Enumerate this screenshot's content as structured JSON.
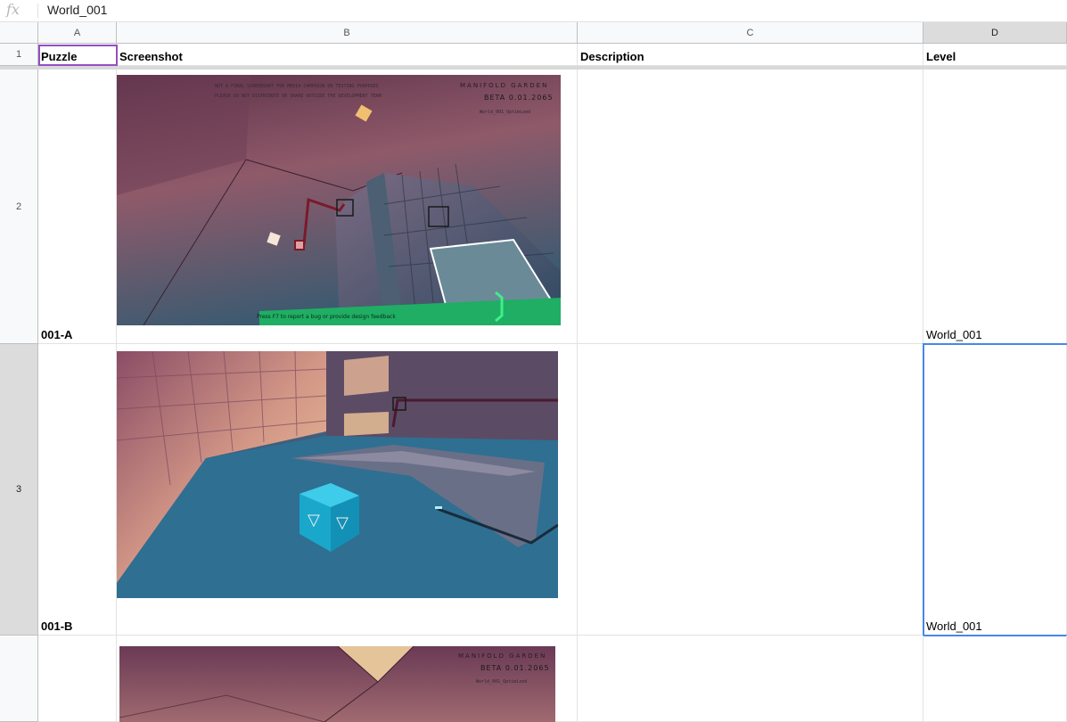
{
  "formula_bar": {
    "icon": "fx-icon",
    "fx_label": "fx",
    "value": "World_001"
  },
  "columns": [
    {
      "id": "A",
      "label": "A"
    },
    {
      "id": "B",
      "label": "B"
    },
    {
      "id": "C",
      "label": "C"
    },
    {
      "id": "D",
      "label": "D"
    }
  ],
  "rows": [
    {
      "num": "1",
      "puzzle": "Puzzle",
      "screenshot": "Screenshot",
      "description": "Description",
      "level": "Level"
    },
    {
      "num": "2",
      "puzzle": "001-A",
      "screenshot_image": "game-screenshot",
      "description": "",
      "level": "World_001",
      "overlay": {
        "line1": "NOT A FINAL SCREENSHOT FOR MEDIA CAMPAIGN OR TESTING PURPOSES",
        "line2": "PLEASE DO NOT DISTRIBUTE OR SHARE OUTSIDE THE DEVELOPMENT TEAM",
        "brand": "MANIFOLD GARDEN",
        "beta": "BETA 0.01.2065",
        "world": "World_001_Optimized",
        "feedback": "Press F7 to report a bug or provide design feedback"
      }
    },
    {
      "num": "3",
      "puzzle": "001-B",
      "screenshot_image": "game-screenshot",
      "description": "",
      "level": "World_001"
    },
    {
      "num": "",
      "puzzle": "",
      "screenshot_image": "game-screenshot",
      "description": "",
      "level": "",
      "overlay": {
        "brand": "MANIFOLD GARDEN",
        "beta": "BETA 0.01.2065",
        "world": "World_001_Optimized"
      }
    }
  ]
}
